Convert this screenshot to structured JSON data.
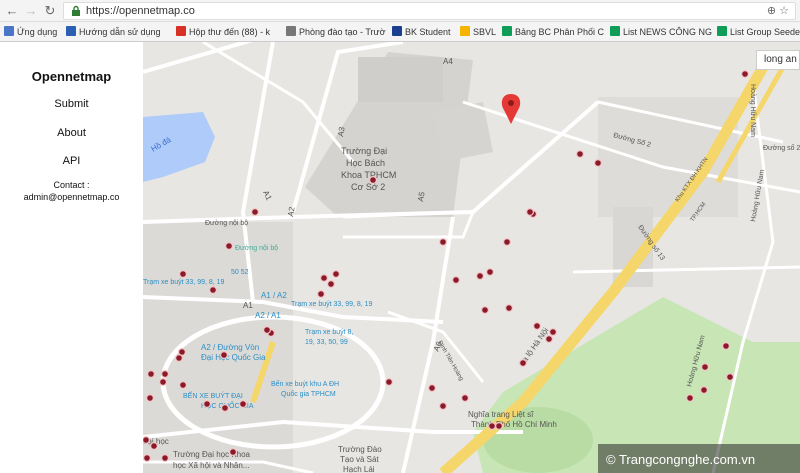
{
  "browser": {
    "url": "https://opennetmap.co",
    "bookmarks": [
      {
        "label": "Ứng dụng",
        "color": "#4a76c7"
      },
      {
        "label": "Hướng dẫn sử dụng",
        "color": "#2b5fb3"
      },
      {
        "label": "Hộp thư đến (88) - k",
        "color": "#d93025"
      },
      {
        "label": "Phòng đào tạo - Trườ",
        "color": "#777777"
      },
      {
        "label": "BK Student",
        "color": "#1a3f8f"
      },
      {
        "label": "SBVL",
        "color": "#f4b400"
      },
      {
        "label": "Bảng BC Phân Phối C",
        "color": "#0f9d58"
      },
      {
        "label": "List NEWS CÔNG NG",
        "color": "#0f9d58"
      },
      {
        "label": "List Group Seeder",
        "color": "#0f9d58"
      }
    ]
  },
  "sidebar": {
    "brand": "Opennetmap",
    "nav": {
      "submit": "Submit",
      "about": "About",
      "api": "API"
    },
    "contact_label": "Contact :",
    "contact_email": "admin@opennetmap.co"
  },
  "map": {
    "search_hint": "long an",
    "labels": {
      "lake": "Hồ đá",
      "campus_line1": "Trường Đại",
      "campus_line2": "Học Bách",
      "campus_line3": "Khoa TPHCM",
      "campus_line4": "Cơ Sở 2",
      "road_noibo": "Đường nội bộ",
      "road_noibo2": "Đường nội bộ",
      "road_so2": "Đường Số 2",
      "road_so2b": "Đường số 2",
      "road_so13": "Đường số 13",
      "road_xahanoi": "Xa lộ Hà Nội",
      "road_hoanghuunam": "Hoàng Hữu Nam",
      "road_hoanghuunam2": "Hoàng Hữu Nam",
      "road_hoanghuunam3": "Hoàng Hữu Nam",
      "road_dinhtienhoang": "Đình Tiên Hoàng",
      "ktx": "Khu KTX ĐH KHTN",
      "ktx2": "TP.HCM",
      "a1a2": "A1 / A2",
      "a2a1": "A2 / A1",
      "a2_route_1": "A2 / Đường Vòn",
      "a2_route_2": "Đại Học Quốc Gia",
      "bus1_1": "Trạm xe buýt 33, 99, 8, 19",
      "bus1_2": "Trạm xe buýt 33, 99, 8, 19",
      "bus2_1": "Trạm xe buýt 8,",
      "bus2_2": "19, 33, 50, 99",
      "bus3_1": "Bến xe buýt khu A ĐH",
      "bus3_2": "Quốc gia TPHCM",
      "bus4_1": "BẾN XE BUÝT ĐẠI",
      "bus4_2": "HỌC QUỐC GIA",
      "a5052": "50 52",
      "a_short": "A1",
      "daihoc": "đại học",
      "khxh_1": "Trường Đại học Khoa",
      "khxh_2": "học Xã hội và Nhân...",
      "htlh_1": "Trường Đào",
      "htlh_2": "Tạo và Sát",
      "htlh_3": "Hạch Lái",
      "cemetery_1": "Nghĩa trang Liệt sĩ",
      "cemetery_2": "Thành Phố Hồ Chí Minh",
      "r_a1": "A1",
      "r_a2": "A2",
      "r_a3": "A3",
      "r_a4": "A4",
      "r_a5": "A5",
      "r_a6": "A6"
    }
  },
  "watermark": "© Trangcongnghe.com.vn",
  "colors": {
    "pin": "#e53935",
    "marker": "#8b1a2b",
    "major_road": "#f5d66b",
    "park": "#c8e6b5"
  }
}
